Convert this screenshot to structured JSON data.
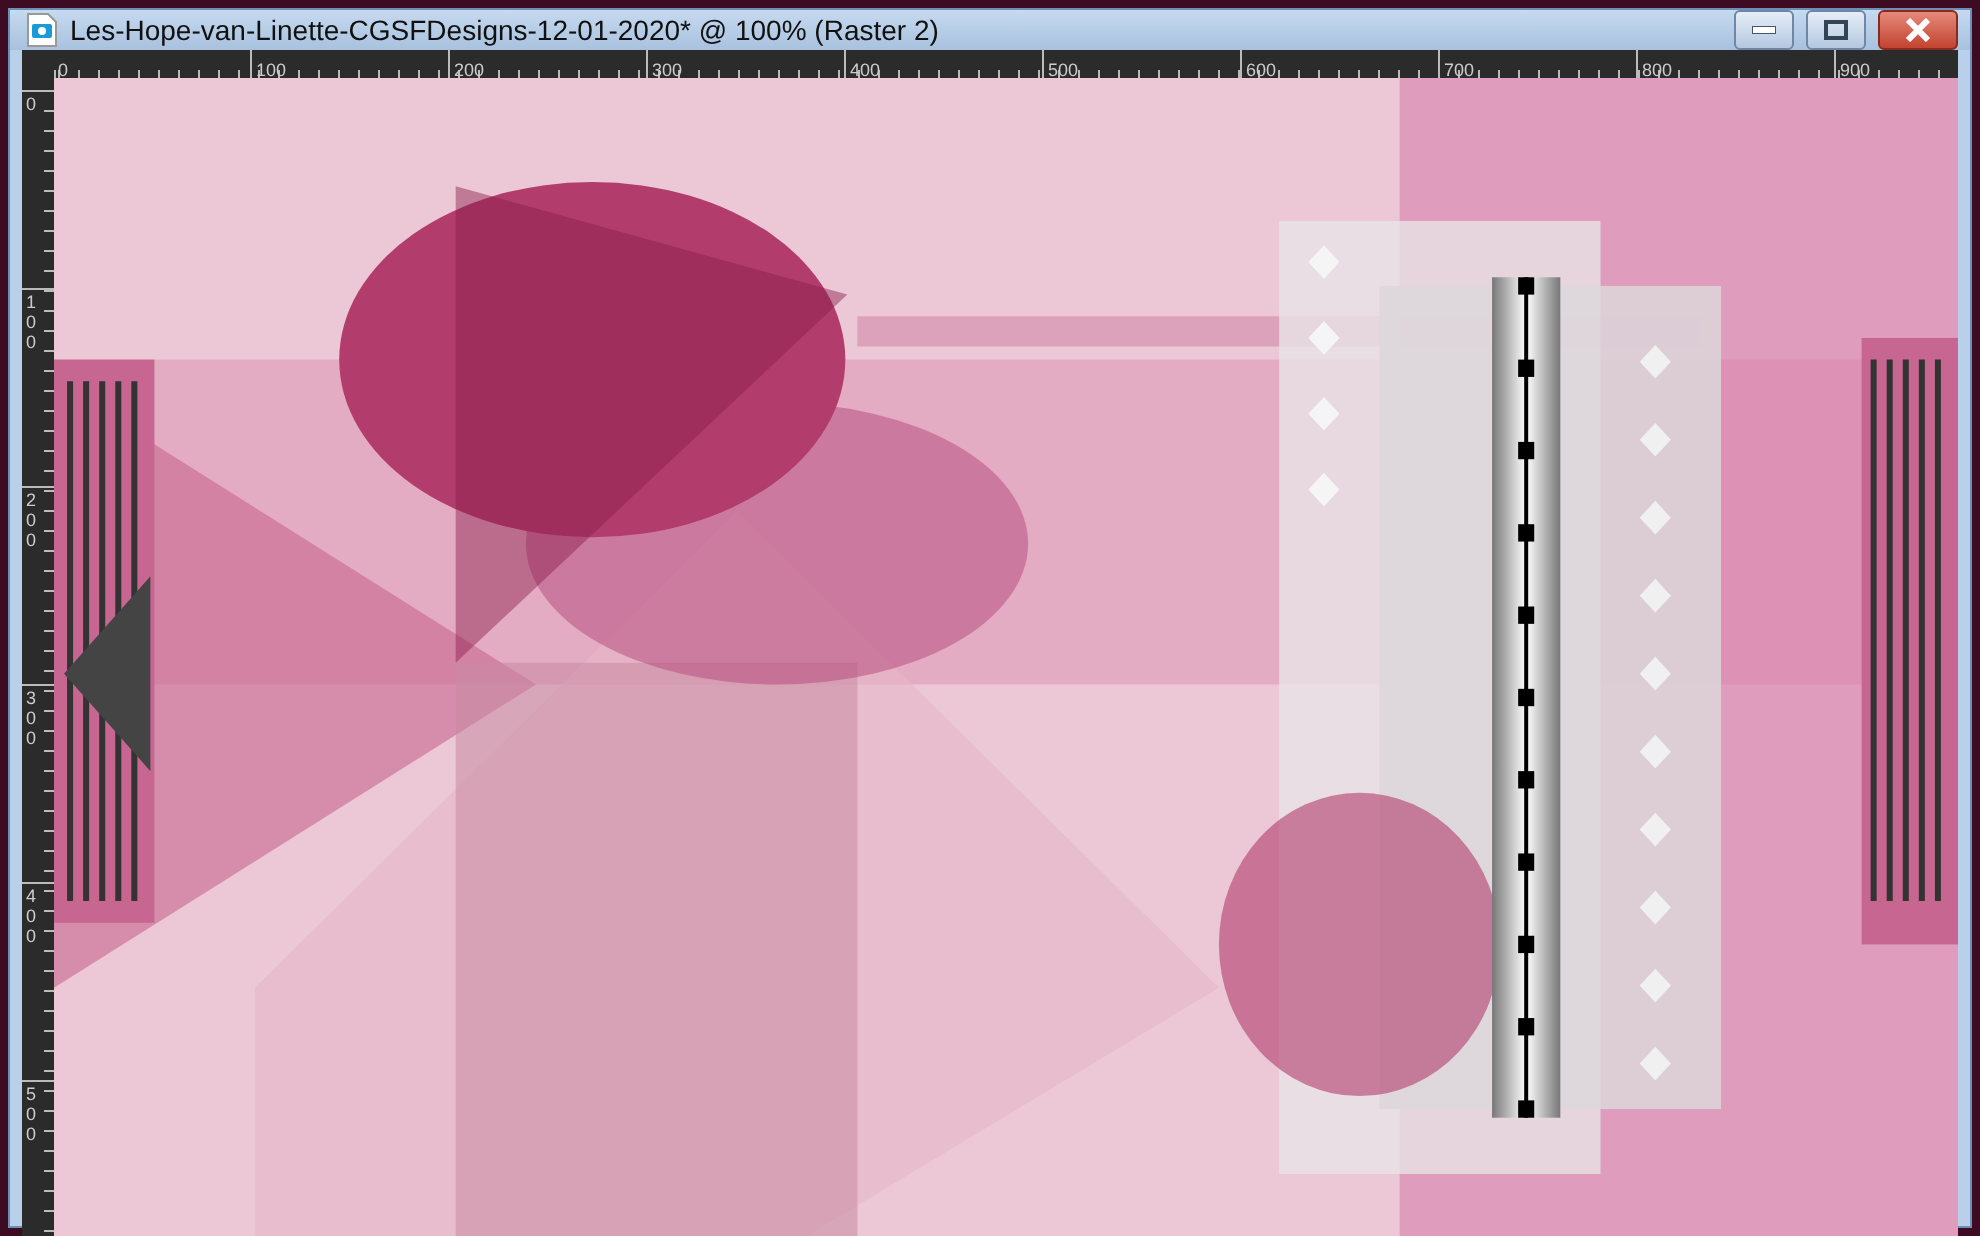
{
  "window": {
    "title": "Les-Hope-van-Linette-CGSFDesigns-12-01-2020* @ 100% (Raster 2)"
  },
  "rulers": {
    "horizontal": [
      "0",
      "100",
      "200",
      "300",
      "400",
      "500",
      "600",
      "700",
      "800",
      "900"
    ],
    "vertical": [
      "0",
      "100",
      "200",
      "300",
      "400",
      "500"
    ]
  }
}
